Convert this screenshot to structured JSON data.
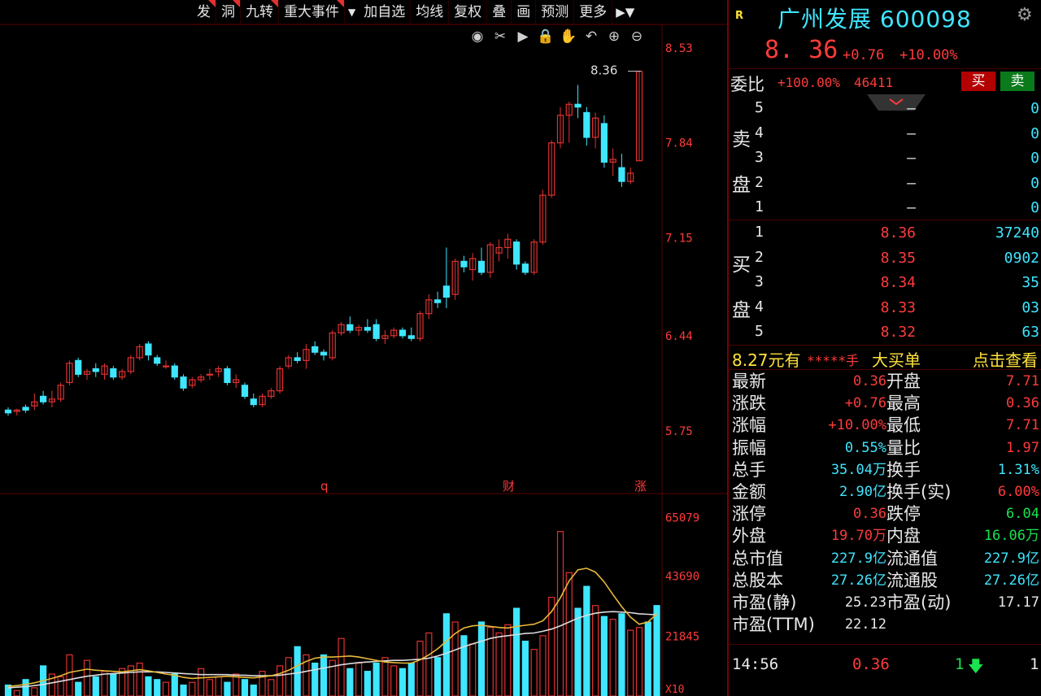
{
  "toolbar": {
    "items": [
      {
        "label": "发",
        "flag": true
      },
      {
        "label": "洞",
        "flag": true
      },
      {
        "label": "九转",
        "flag": true
      },
      {
        "label": "重大事件",
        "flag": true
      },
      {
        "label": "加自选",
        "flag": false
      },
      {
        "label": "均线",
        "flag": false
      },
      {
        "label": "复权",
        "flag": false
      },
      {
        "label": "叠",
        "flag": false
      },
      {
        "label": "画",
        "flag": false
      },
      {
        "label": "预测",
        "flag": false
      },
      {
        "label": "更多",
        "flag": false
      }
    ],
    "dropdown_glyph": "▼",
    "more_glyph": "▶▼"
  },
  "chart_tools": [
    "eye-icon",
    "scissors-icon",
    "play-icon",
    "lock-icon",
    "hand-icon",
    "undo-icon",
    "zoom-in-icon",
    "zoom-out-icon"
  ],
  "chart_data": [
    {
      "type": "candlestick",
      "y_ticks": [
        "8.53",
        "7.84",
        "7.15",
        "6.44",
        "5.75"
      ],
      "ylim": [
        5.3,
        8.7
      ],
      "last_price_label": "8.36",
      "markers": [
        "q",
        "财",
        "涨"
      ],
      "candles": [
        {
          "o": 5.9,
          "h": 5.92,
          "l": 5.86,
          "c": 5.88
        },
        {
          "o": 5.89,
          "h": 5.91,
          "l": 5.86,
          "c": 5.9
        },
        {
          "o": 5.92,
          "h": 5.94,
          "l": 5.88,
          "c": 5.9
        },
        {
          "o": 5.93,
          "h": 6.02,
          "l": 5.9,
          "c": 5.96
        },
        {
          "o": 6.0,
          "h": 6.04,
          "l": 5.94,
          "c": 5.96
        },
        {
          "o": 5.96,
          "h": 6.04,
          "l": 5.92,
          "c": 5.98
        },
        {
          "o": 5.98,
          "h": 6.1,
          "l": 5.96,
          "c": 6.08
        },
        {
          "o": 6.1,
          "h": 6.26,
          "l": 6.08,
          "c": 6.24
        },
        {
          "o": 6.26,
          "h": 6.28,
          "l": 6.14,
          "c": 6.16
        },
        {
          "o": 6.16,
          "h": 6.2,
          "l": 6.12,
          "c": 6.18
        },
        {
          "o": 6.2,
          "h": 6.24,
          "l": 6.14,
          "c": 6.18
        },
        {
          "o": 6.16,
          "h": 6.24,
          "l": 6.12,
          "c": 6.22
        },
        {
          "o": 6.2,
          "h": 6.22,
          "l": 6.12,
          "c": 6.14
        },
        {
          "o": 6.14,
          "h": 6.2,
          "l": 6.12,
          "c": 6.18
        },
        {
          "o": 6.18,
          "h": 6.3,
          "l": 6.16,
          "c": 6.28
        },
        {
          "o": 6.28,
          "h": 6.38,
          "l": 6.26,
          "c": 6.36
        },
        {
          "o": 6.38,
          "h": 6.4,
          "l": 6.26,
          "c": 6.3
        },
        {
          "o": 6.28,
          "h": 6.3,
          "l": 6.22,
          "c": 6.24
        },
        {
          "o": 6.22,
          "h": 6.26,
          "l": 6.2,
          "c": 6.22
        },
        {
          "o": 6.22,
          "h": 6.24,
          "l": 6.12,
          "c": 6.14
        },
        {
          "o": 6.14,
          "h": 6.16,
          "l": 6.04,
          "c": 6.06
        },
        {
          "o": 6.08,
          "h": 6.14,
          "l": 6.06,
          "c": 6.12
        },
        {
          "o": 6.12,
          "h": 6.16,
          "l": 6.1,
          "c": 6.14
        },
        {
          "o": 6.16,
          "h": 6.2,
          "l": 6.12,
          "c": 6.16
        },
        {
          "o": 6.18,
          "h": 6.22,
          "l": 6.14,
          "c": 6.2
        },
        {
          "o": 6.2,
          "h": 6.22,
          "l": 6.08,
          "c": 6.1
        },
        {
          "o": 6.1,
          "h": 6.16,
          "l": 6.06,
          "c": 6.12
        },
        {
          "o": 6.08,
          "h": 6.1,
          "l": 5.98,
          "c": 6.0
        },
        {
          "o": 5.98,
          "h": 6.02,
          "l": 5.92,
          "c": 5.94
        },
        {
          "o": 5.94,
          "h": 6.02,
          "l": 5.92,
          "c": 6.0
        },
        {
          "o": 6.0,
          "h": 6.06,
          "l": 5.98,
          "c": 6.04
        },
        {
          "o": 6.04,
          "h": 6.22,
          "l": 6.02,
          "c": 6.2
        },
        {
          "o": 6.22,
          "h": 6.3,
          "l": 6.2,
          "c": 6.28
        },
        {
          "o": 6.28,
          "h": 6.32,
          "l": 6.24,
          "c": 6.26
        },
        {
          "o": 6.26,
          "h": 6.38,
          "l": 6.2,
          "c": 6.34
        },
        {
          "o": 6.36,
          "h": 6.4,
          "l": 6.3,
          "c": 6.32
        },
        {
          "o": 6.32,
          "h": 6.34,
          "l": 6.26,
          "c": 6.3
        },
        {
          "o": 6.28,
          "h": 6.48,
          "l": 6.26,
          "c": 6.46
        },
        {
          "o": 6.46,
          "h": 6.54,
          "l": 6.44,
          "c": 6.52
        },
        {
          "o": 6.52,
          "h": 6.58,
          "l": 6.46,
          "c": 6.48
        },
        {
          "o": 6.48,
          "h": 6.52,
          "l": 6.44,
          "c": 6.5
        },
        {
          "o": 6.5,
          "h": 6.56,
          "l": 6.46,
          "c": 6.48
        },
        {
          "o": 6.52,
          "h": 6.56,
          "l": 6.4,
          "c": 6.42
        },
        {
          "o": 6.42,
          "h": 6.48,
          "l": 6.38,
          "c": 6.44
        },
        {
          "o": 6.44,
          "h": 6.5,
          "l": 6.42,
          "c": 6.48
        },
        {
          "o": 6.48,
          "h": 6.5,
          "l": 6.42,
          "c": 6.44
        },
        {
          "o": 6.44,
          "h": 6.5,
          "l": 6.4,
          "c": 6.42
        },
        {
          "o": 6.42,
          "h": 6.62,
          "l": 6.4,
          "c": 6.6
        },
        {
          "o": 6.6,
          "h": 6.74,
          "l": 6.56,
          "c": 6.7
        },
        {
          "o": 6.7,
          "h": 6.76,
          "l": 6.64,
          "c": 6.68
        },
        {
          "o": 6.8,
          "h": 7.08,
          "l": 6.64,
          "c": 6.72
        },
        {
          "o": 6.74,
          "h": 7.0,
          "l": 6.7,
          "c": 6.98
        },
        {
          "o": 6.98,
          "h": 7.02,
          "l": 6.9,
          "c": 6.94
        },
        {
          "o": 6.92,
          "h": 7.04,
          "l": 6.84,
          "c": 7.0
        },
        {
          "o": 6.98,
          "h": 7.08,
          "l": 6.88,
          "c": 6.9
        },
        {
          "o": 6.9,
          "h": 7.12,
          "l": 6.86,
          "c": 7.1
        },
        {
          "o": 7.04,
          "h": 7.14,
          "l": 6.98,
          "c": 7.08
        },
        {
          "o": 7.08,
          "h": 7.18,
          "l": 7.0,
          "c": 7.14
        },
        {
          "o": 7.12,
          "h": 7.14,
          "l": 6.92,
          "c": 6.96
        },
        {
          "o": 6.96,
          "h": 6.98,
          "l": 6.88,
          "c": 6.9
        },
        {
          "o": 6.9,
          "h": 7.14,
          "l": 6.88,
          "c": 7.12
        },
        {
          "o": 7.12,
          "h": 7.5,
          "l": 7.1,
          "c": 7.46
        },
        {
          "o": 7.46,
          "h": 7.86,
          "l": 7.44,
          "c": 7.84
        },
        {
          "o": 7.84,
          "h": 8.1,
          "l": 7.8,
          "c": 8.04
        },
        {
          "o": 8.04,
          "h": 8.14,
          "l": 7.84,
          "c": 8.12
        },
        {
          "o": 8.12,
          "h": 8.26,
          "l": 8.02,
          "c": 8.1
        },
        {
          "o": 8.06,
          "h": 8.1,
          "l": 7.82,
          "c": 7.88
        },
        {
          "o": 7.88,
          "h": 8.06,
          "l": 7.8,
          "c": 8.02
        },
        {
          "o": 7.98,
          "h": 8.04,
          "l": 7.66,
          "c": 7.7
        },
        {
          "o": 7.7,
          "h": 7.8,
          "l": 7.6,
          "c": 7.72
        },
        {
          "o": 7.66,
          "h": 7.76,
          "l": 7.52,
          "c": 7.56
        },
        {
          "o": 7.56,
          "h": 7.66,
          "l": 7.54,
          "c": 7.62
        },
        {
          "o": 7.71,
          "h": 8.36,
          "l": 7.71,
          "c": 8.36
        }
      ]
    },
    {
      "type": "bar",
      "y_ticks": [
        "65079",
        "43690",
        "21845"
      ],
      "ylim": [
        0,
        70000
      ],
      "unit_label": "X10",
      "volumes": [
        4000,
        2000,
        6000,
        3000,
        11000,
        8000,
        7000,
        15000,
        5000,
        13000,
        7000,
        9000,
        8000,
        10000,
        11000,
        12000,
        7000,
        6000,
        5000,
        8000,
        4000,
        5000,
        10000,
        6000,
        7000,
        5000,
        8000,
        6000,
        4000,
        9000,
        6000,
        11000,
        14000,
        18000,
        15000,
        12000,
        15000,
        13000,
        21000,
        10000,
        12000,
        9000,
        12000,
        14000,
        11000,
        10000,
        12000,
        20000,
        23000,
        14000,
        30000,
        27000,
        22000,
        19000,
        27000,
        25000,
        23000,
        26000,
        32000,
        20000,
        17000,
        22000,
        36000,
        60000,
        45000,
        32000,
        40000,
        33000,
        29000,
        28000,
        30000,
        24000,
        25000,
        27000,
        33000
      ],
      "ma_short": [
        3500,
        3800,
        4200,
        4800,
        5600,
        6400,
        7400,
        8600,
        9200,
        9800,
        9400,
        9200,
        9000,
        8800,
        9200,
        9600,
        9200,
        8600,
        8000,
        7600,
        6800,
        6400,
        6600,
        6800,
        7000,
        7200,
        7000,
        6800,
        6600,
        7000,
        7400,
        8200,
        9400,
        11000,
        12600,
        13800,
        14200,
        14200,
        14400,
        14600,
        14200,
        13600,
        13000,
        12400,
        12200,
        12000,
        12000,
        13200,
        15000,
        17200,
        20000,
        22800,
        24800,
        25600,
        25800,
        25400,
        25000,
        24800,
        25400,
        25800,
        26200,
        27400,
        30800,
        35800,
        42000,
        46000,
        46600,
        45200,
        41600,
        37000,
        32600,
        28800,
        26200,
        27000,
        30000
      ],
      "ma_long": [
        3000,
        3200,
        3400,
        3800,
        4200,
        4800,
        5400,
        6000,
        6600,
        7200,
        7600,
        8000,
        8200,
        8400,
        8600,
        8800,
        8800,
        8800,
        8600,
        8400,
        8200,
        8000,
        7800,
        7800,
        7800,
        7800,
        7600,
        7600,
        7400,
        7400,
        7400,
        7600,
        8000,
        8400,
        9000,
        9600,
        10200,
        10800,
        11400,
        11800,
        12200,
        12400,
        12600,
        12800,
        13000,
        13000,
        13200,
        13400,
        13800,
        14600,
        15600,
        16800,
        18000,
        19000,
        20000,
        21000,
        21600,
        22000,
        22400,
        22800,
        23000,
        23600,
        24400,
        25600,
        27000,
        28400,
        29400,
        30200,
        30600,
        30800,
        30600,
        30400,
        30000,
        29800,
        29600
      ]
    }
  ],
  "panel": {
    "badge": "R",
    "title": "广州发展 600098",
    "price": "8. 36",
    "change": "+0.76",
    "change_pct": "+10.00%",
    "wb_label": "委比",
    "wb_pct": "+100.00%",
    "wb_num": "46411",
    "buy_label": "买",
    "sell_label": "卖",
    "sell_side_chars": [
      "卖",
      "盘"
    ],
    "buy_side_chars": [
      "买",
      "盘"
    ],
    "asks": [
      {
        "level": "5",
        "price": "–",
        "vol": "0"
      },
      {
        "level": "4",
        "price": "–",
        "vol": "0"
      },
      {
        "level": "3",
        "price": "–",
        "vol": "0"
      },
      {
        "level": "2",
        "price": "–",
        "vol": "0"
      },
      {
        "level": "1",
        "price": "–",
        "vol": "0"
      }
    ],
    "bids": [
      {
        "level": "1",
        "price": "8.36",
        "vol": "37240"
      },
      {
        "level": "2",
        "price": "8.35",
        "vol": "0902"
      },
      {
        "level": "3",
        "price": "8.34",
        "vol": "35"
      },
      {
        "level": "4",
        "price": "8.33",
        "vol": "03"
      },
      {
        "level": "5",
        "price": "8.32",
        "vol": "63"
      }
    ],
    "promo": {
      "p1": "8.27元有",
      "p2": "*****手",
      "p3": "大买单",
      "p4": "点击查看"
    },
    "stats_left": [
      {
        "k": "最新",
        "v": "0.36",
        "c": "red"
      },
      {
        "k": "涨跌",
        "v": "+0.76",
        "c": "red"
      },
      {
        "k": "涨幅",
        "v": "+10.00%",
        "c": "red"
      },
      {
        "k": "振幅",
        "v": "0.55%",
        "c": "cyan"
      },
      {
        "k": "总手",
        "v": "35.04万",
        "c": "cyan"
      },
      {
        "k": "金额",
        "v": "2.90亿",
        "c": "cyan"
      },
      {
        "k": "涨停",
        "v": "0.36",
        "c": "red"
      },
      {
        "k": "外盘",
        "v": "19.70万",
        "c": "red"
      },
      {
        "k": "总市值",
        "v": "227.9亿",
        "c": "cyan"
      },
      {
        "k": "总股本",
        "v": "27.26亿",
        "c": "cyan"
      },
      {
        "k": "市盈(静)",
        "v": "25.23",
        "c": "white"
      },
      {
        "k": "市盈(TTM)",
        "v": "22.12",
        "c": "white"
      }
    ],
    "stats_right": [
      {
        "k": "开盘",
        "v": "7.71",
        "c": "red"
      },
      {
        "k": "最高",
        "v": "0.36",
        "c": "red"
      },
      {
        "k": "最低",
        "v": "7.71",
        "c": "red"
      },
      {
        "k": "量比",
        "v": "1.97",
        "c": "red"
      },
      {
        "k": "换手",
        "v": "1.31%",
        "c": "cyan"
      },
      {
        "k": "换手(实)",
        "v": "6.00%",
        "c": "red"
      },
      {
        "k": "跌停",
        "v": "6.04",
        "c": "green"
      },
      {
        "k": "内盘",
        "v": "16.06万",
        "c": "green"
      },
      {
        "k": "流通值",
        "v": "227.9亿",
        "c": "cyan"
      },
      {
        "k": "流通股",
        "v": "27.26亿",
        "c": "cyan"
      },
      {
        "k": "市盈(动)",
        "v": "17.17",
        "c": "white"
      }
    ],
    "tick": {
      "time": "14:56",
      "price": "0.36",
      "vol": "1",
      "dir": "down",
      "extra": "1"
    }
  },
  "colors": {
    "up": "#e23131",
    "down": "#3fe6ff",
    "ma_short": "#e8b93a",
    "ma_long": "#dcdcdc",
    "grid": "#5a0000",
    "axis": "#ff3b3b"
  }
}
